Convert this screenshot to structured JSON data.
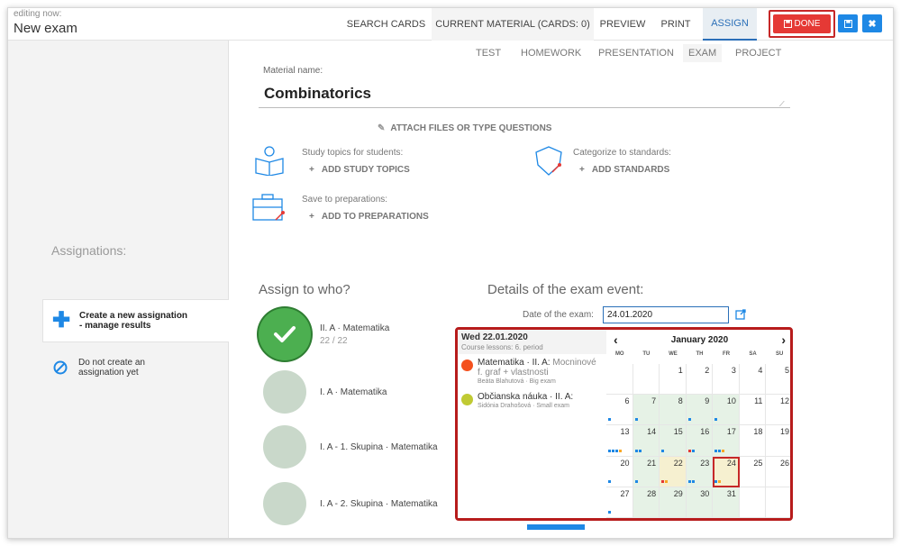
{
  "header": {
    "editing_label": "editing now:",
    "title": "New exam",
    "tabs": [
      {
        "label": "SEARCH CARDS"
      },
      {
        "label": "CURRENT MATERIAL (CARDS: 0)"
      },
      {
        "label": "PREVIEW"
      },
      {
        "label": "PRINT"
      },
      {
        "label": "ASSIGN"
      }
    ],
    "done_label": "DONE",
    "active_tab": "ASSIGN"
  },
  "material_types": [
    "TEST",
    "HOMEWORK",
    "PRESENTATION",
    "EXAM",
    "PROJECT"
  ],
  "material": {
    "label": "Material name:",
    "name": "Combinatorics",
    "attach_label": "ATTACH FILES OR TYPE QUESTIONS",
    "study_topics_label": "Study topics for students:",
    "add_study_topics": "ADD STUDY TOPICS",
    "standards_label": "Categorize to standards:",
    "add_standards": "ADD STANDARDS",
    "preparations_label": "Save to preparations:",
    "add_preparations": "ADD TO PREPARATIONS"
  },
  "sidebar": {
    "heading": "Assignations:",
    "items": [
      {
        "line1": "Create a new assignation",
        "line2": "- manage results",
        "selected": true
      },
      {
        "line1": "Do not create an",
        "line2": "assignation yet",
        "selected": false
      }
    ]
  },
  "assign": {
    "heading": "Assign to who?",
    "classes": [
      {
        "name": "II. A · Matematika",
        "count": "22 / 22",
        "selected": true
      },
      {
        "name": "I. A · Matematika",
        "count": "",
        "selected": false
      },
      {
        "name": "I. A - 1. Skupina · Matematika",
        "count": "",
        "selected": false
      },
      {
        "name": "I. A - 2. Skupina · Matematika",
        "count": "",
        "selected": false
      }
    ]
  },
  "details": {
    "heading": "Details of the exam event:",
    "date_label": "Date of the exam:",
    "date_value": "24.01.2020"
  },
  "popup": {
    "day_title": "Wed 22.01.2020",
    "lessons_note": "Course lessons: 6. period",
    "lessons": [
      {
        "title": "Matematika · II. A:",
        "desc": "Mocninové f. graf + vlastnosti",
        "meta": "Beáta Blahutová · Big exam",
        "color": "#f4511e"
      },
      {
        "title": "Občianska náuka · II. A:",
        "desc": "",
        "meta": "Sidónia Drahošová · Small exam",
        "color": "#c0ca33"
      }
    ],
    "calendar": {
      "month": "January 2020",
      "prev": "‹",
      "next": "›",
      "dow": [
        "MO",
        "TU",
        "WE",
        "TH",
        "FR",
        "SA",
        "SU"
      ],
      "weeks": [
        [
          "",
          "",
          "1",
          "2",
          "3",
          "4",
          "5"
        ],
        [
          "6",
          "7",
          "8",
          "9",
          "10",
          "11",
          "12"
        ],
        [
          "13",
          "14",
          "15",
          "16",
          "17",
          "18",
          "19"
        ],
        [
          "20",
          "21",
          "22",
          "23",
          "24",
          "25",
          "26"
        ],
        [
          "27",
          "28",
          "29",
          "30",
          "31",
          "",
          ""
        ]
      ],
      "selected_day": "24",
      "highlight_day": "22"
    }
  },
  "colors": {
    "accent": "#2a6fb8",
    "done": "#e53935",
    "highlight_border": "#c62828",
    "week_green": "#e6f2e6"
  }
}
